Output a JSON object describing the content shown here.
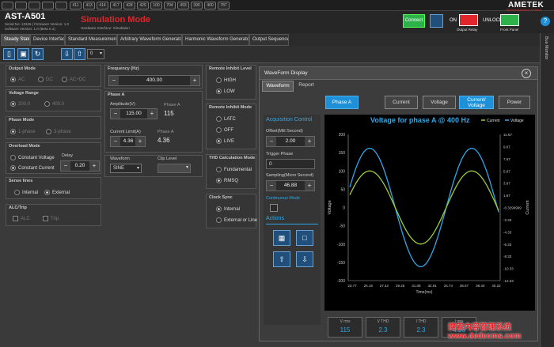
{
  "toolbar_top": {
    "icons": [
      "411",
      "413",
      "414",
      "417",
      "428",
      "429",
      "100",
      "704",
      "493",
      "390",
      "400",
      "787"
    ]
  },
  "header": {
    "app": "AST-A501",
    "serial_line": "Serial No: 12345 | Firmware Version: 1.0",
    "software_line": "Software Version: 1.0 (Beta 0.1)",
    "mode": "Simulation Mode",
    "hw_line": "Hardware Interface: Simulation",
    "connect": "Connect",
    "on": "ON",
    "unlock": "UNLOCK",
    "output_relay": "Output Relay",
    "front_panel": "Front Panel",
    "brand": "AMETEK",
    "brand_sub": "PROGRAMMABLE POWER"
  },
  "tabs": [
    "Steady State",
    "Device Interface",
    "Standard Measurements",
    "Arbitrary Waveform Generator",
    "Harmonic Waveform Generator",
    "Output Sequencer"
  ],
  "tool": {
    "dropdown": "0"
  },
  "left": {
    "output_mode": {
      "title": "Output Mode",
      "o": [
        "AC",
        "DC",
        "AC+DC"
      ]
    },
    "voltage_range": {
      "title": "Voltage Range",
      "o": [
        "200.0",
        "400.0"
      ]
    },
    "phase_mode": {
      "title": "Phase Mode",
      "o": [
        "1-phase",
        "3-phase"
      ]
    },
    "overload": {
      "title": "Overload Mode",
      "o": [
        "Constant Voltage",
        "Constant Current"
      ],
      "delay_label": "Delay",
      "delay": "0.20"
    },
    "sense": {
      "title": "Sense lines",
      "o": [
        "Internal",
        "External"
      ]
    },
    "alc": {
      "title": "ALC/Trip",
      "o": [
        "ALC",
        "Trip"
      ]
    }
  },
  "mid": {
    "freq_title": "Frequency (Hz)",
    "freq": "400.00",
    "phase_title": "Phase A",
    "amp_label": "Amplitude(V)",
    "amp": "115.00",
    "phase_a": "Phase A",
    "phase_a_val": "115",
    "cl_label": "Current Limit(A)",
    "cl": "4.36",
    "cl_pa": "Phase A",
    "cl_pa_val": "4.36",
    "wf_label": "Waveform",
    "wf": "SINE",
    "clip_label": "Clip Level"
  },
  "right": {
    "rii_level": {
      "title": "Remote Inhibit Level",
      "o": [
        "HIGH",
        "LOW"
      ]
    },
    "rii_mode": {
      "title": "Remote Inhibit Mode",
      "o": [
        "LATC",
        "OFF",
        "LIVE"
      ]
    },
    "thd": {
      "title": "THD Calculation Mode",
      "o": [
        "Fundamental",
        "RMSQ"
      ]
    },
    "clock": {
      "title": "Clock Sync",
      "o": [
        "Internal",
        "External or Line"
      ]
    }
  },
  "dialog": {
    "title": "WaveForm Display",
    "tabs": [
      "Waveform",
      "Report"
    ],
    "phase_btn": "Phase A",
    "btns": [
      "Current",
      "Voltage",
      "Current/ Voltage",
      "Power"
    ],
    "acq": "Acquisition Control",
    "offset_label": "Offset(Mili Second)",
    "offset": "2.00",
    "trigger_label": "Trigger Phase",
    "trigger": "0",
    "sampling_label": "Sampling(Micro Second)",
    "sampling": "46.88",
    "continuous": "Continuous Mode",
    "actions": "Actions",
    "meas": [
      {
        "l": "V rms",
        "v": "115"
      },
      {
        "l": "V THD",
        "v": "2.3"
      },
      {
        "l": "I THD",
        "v": "2.3"
      },
      {
        "l": "I rms",
        "v": "4.36"
      }
    ]
  },
  "bus_monitor": "Bus Monitor",
  "chart_data": {
    "type": "line",
    "title": "Voltage for phase A @ 400 Hz",
    "legend": [
      "Current",
      "Voltage"
    ],
    "xlabel": "Time(ms)",
    "ylabel": "Voltage",
    "y2label": "Current",
    "xticks": [
      "23.77",
      "25.19",
      "27.42",
      "29.25",
      "31.08",
      "32.91",
      "34.74",
      "36.57",
      "38.40",
      "40.22"
    ],
    "yticks": [
      "200",
      "150",
      "100",
      "50",
      "0",
      "-50",
      "-100",
      "-150",
      "-200"
    ],
    "y2ticks": [
      "11.67",
      "9.67",
      "7.67",
      "5.67",
      "3.67",
      "1.67",
      "-0.3299999",
      "-2.33",
      "-4.33",
      "-6.33",
      "-8.33",
      "-10.33",
      "-12.33"
    ],
    "ylim": [
      -200,
      200
    ],
    "series": [
      {
        "name": "Voltage",
        "amplitude": 162,
        "color": "#2ea8e8"
      },
      {
        "name": "Current",
        "amplitude": 100,
        "color": "#9ccc3c"
      }
    ]
  },
  "watermark": "搜索内容管理系统 www.dedecms.com",
  "colors": {
    "accent": "#1e90d8",
    "red": "#e0252b",
    "green": "#2db24a"
  }
}
